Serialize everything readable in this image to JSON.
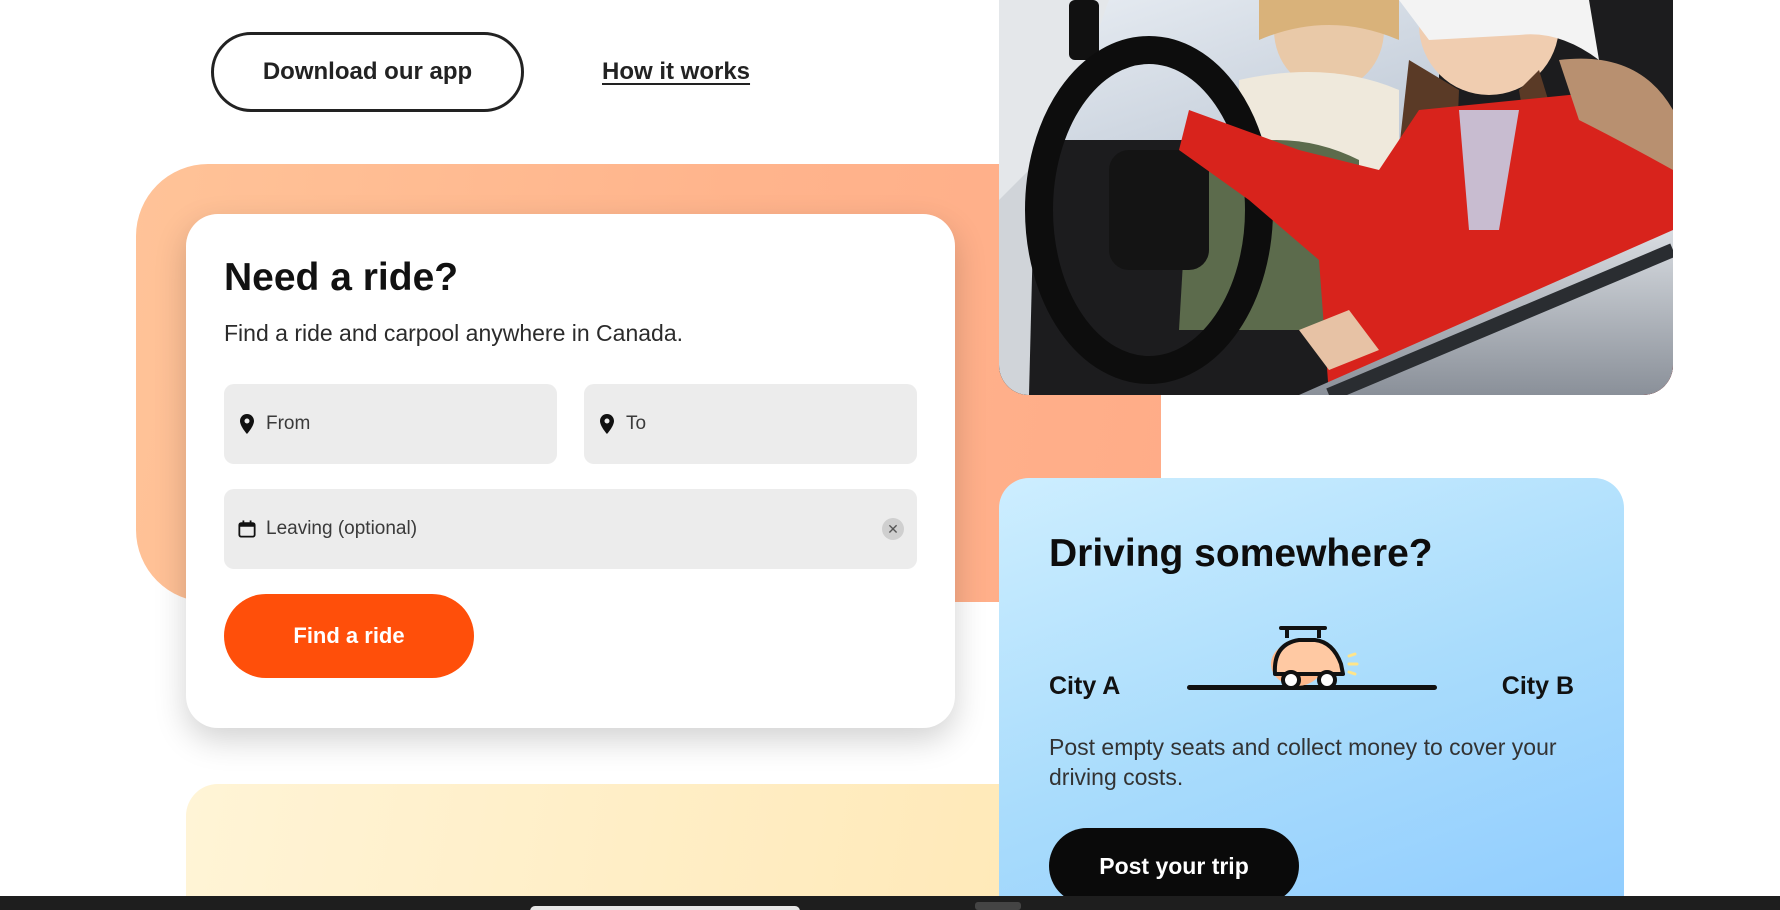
{
  "top": {
    "download_label": "Download our app",
    "how_label": "How it works"
  },
  "ride": {
    "title": "Need a ride?",
    "subtitle": "Find a ride and carpool anywhere in Canada.",
    "from_placeholder": "From",
    "to_placeholder": "To",
    "leaving_placeholder": "Leaving (optional)",
    "clear_symbol": "✕",
    "find_label": "Find a ride"
  },
  "drive": {
    "title": "Driving somewhere?",
    "city_a": "City A",
    "city_b": "City B",
    "description": "Post empty seats and collect money to cover your driving costs.",
    "post_label": "Post your trip"
  },
  "colors": {
    "accent_orange": "#ff4f0a",
    "peach": "#ffb48c",
    "sky": "#a9dcfc",
    "dark": "#0a0a0a"
  },
  "icons": [
    "location-pin-icon",
    "calendar-icon",
    "clear-icon",
    "car-icon"
  ]
}
